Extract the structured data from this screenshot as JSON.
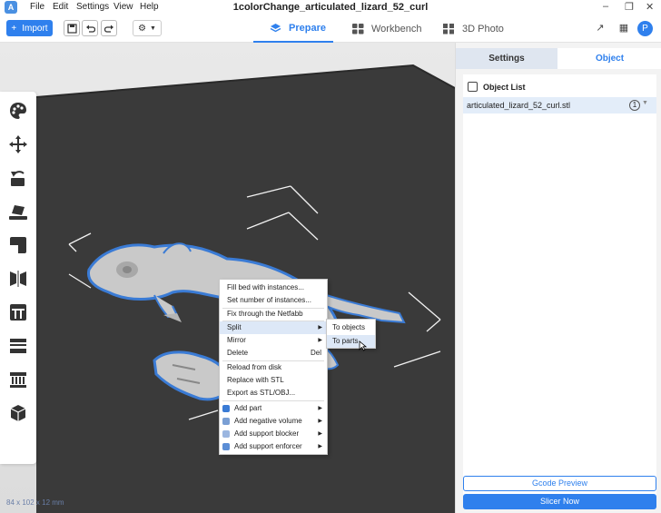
{
  "app": {
    "title": "1colorChange_articulated_lizard_52_curl",
    "logo": "A"
  },
  "menu": [
    "File",
    "Edit",
    "Settings",
    "View",
    "Help"
  ],
  "toolbar": {
    "import_label": "Import",
    "import_icon": "+"
  },
  "tabs": [
    {
      "label": "Prepare",
      "active": true
    },
    {
      "label": "Workbench",
      "active": false
    },
    {
      "label": "3D Photo",
      "active": false
    }
  ],
  "user": {
    "avatar": "P"
  },
  "viewport": {
    "dims": "84 x 102 x 12 mm"
  },
  "context_menu": {
    "items": [
      {
        "label": "Fill bed with instances..."
      },
      {
        "label": "Set number of instances..."
      },
      {
        "label": "Fix through the Netfabb"
      },
      {
        "label": "Split",
        "submenu": true
      },
      {
        "label": "Mirror",
        "submenu": true
      },
      {
        "label": "Delete",
        "shortcut": "Del"
      },
      {
        "label": "Reload from disk"
      },
      {
        "label": "Replace with STL"
      },
      {
        "label": "Export as STL/OBJ..."
      },
      {
        "label": "Add part",
        "submenu": true
      },
      {
        "label": "Add negative volume",
        "submenu": true
      },
      {
        "label": "Add support blocker",
        "submenu": true
      },
      {
        "label": "Add support enforcer",
        "submenu": true
      }
    ],
    "split_submenu": [
      "To objects",
      "To parts"
    ]
  },
  "right_panel": {
    "tabs": [
      {
        "label": "Settings",
        "active": false
      },
      {
        "label": "Object",
        "active": true
      }
    ],
    "object_list_title": "Object List",
    "objects": [
      {
        "name": "articulated_lizard_52_curl.stl",
        "badge": "1"
      }
    ],
    "gcode_preview": "Gcode Preview",
    "slicer_now": "Slicer Now"
  },
  "colors": {
    "accent": "#2f80ed",
    "bed": "#3a3a3a",
    "model": "#c9c9c9",
    "selection": "#3a7bd5"
  }
}
